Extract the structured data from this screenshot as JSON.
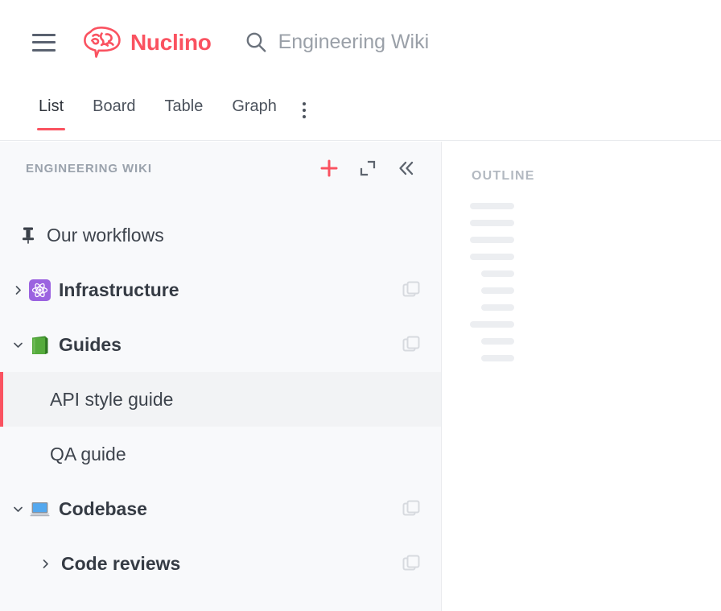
{
  "brand": {
    "name": "Nuclino",
    "color": "#fa5260",
    "logo_icon": "brain-speech-bubble-icon",
    "menu_icon": "hamburger-menu-icon"
  },
  "search": {
    "icon": "search-icon",
    "value": "Engineering Wiki",
    "placeholder": "Engineering Wiki"
  },
  "tabs": {
    "items": [
      {
        "label": "List",
        "active": true
      },
      {
        "label": "Board",
        "active": false
      },
      {
        "label": "Table",
        "active": false
      },
      {
        "label": "Graph",
        "active": false
      }
    ],
    "more_icon": "more-vertical-icon",
    "active_indicator_color": "#fa5260"
  },
  "sidebar": {
    "title": "ENGINEERING WIKI",
    "actions": [
      {
        "name": "add-item-button",
        "icon": "plus-icon",
        "color": "#fa5260"
      },
      {
        "name": "expand-button",
        "icon": "expand-diagonal-icon",
        "color": "#6b7280"
      },
      {
        "name": "collapse-sidebar-button",
        "icon": "chevron-double-left-icon",
        "color": "#6b7280"
      }
    ],
    "items": [
      {
        "label": "Our workflows",
        "icon": "pushpin-icon",
        "emoji": "",
        "toggle": "none",
        "indent": 0,
        "bold": false,
        "selected": false,
        "has_copy": false
      },
      {
        "label": "Infrastructure",
        "icon": "atom-emoji",
        "emoji": "⚛",
        "toggle": "collapsed",
        "indent": 0,
        "bold": true,
        "selected": false,
        "has_copy": true
      },
      {
        "label": "Guides",
        "icon": "green-book-emoji",
        "emoji": "📗",
        "toggle": "expanded",
        "indent": 0,
        "bold": true,
        "selected": false,
        "has_copy": true
      },
      {
        "label": "API style guide",
        "icon": "",
        "emoji": "",
        "toggle": "none",
        "indent": 1,
        "bold": false,
        "selected": true,
        "has_copy": false
      },
      {
        "label": "QA guide",
        "icon": "",
        "emoji": "",
        "toggle": "none",
        "indent": 1,
        "bold": false,
        "selected": false,
        "has_copy": false
      },
      {
        "label": "Codebase",
        "icon": "laptop-emoji",
        "emoji": "💻",
        "toggle": "expanded",
        "indent": 0,
        "bold": true,
        "selected": false,
        "has_copy": true
      },
      {
        "label": "Code reviews",
        "icon": "",
        "emoji": "",
        "toggle": "collapsed",
        "indent": 2,
        "bold": true,
        "selected": false,
        "has_copy": true
      }
    ],
    "copy_icon": "duplicate-icon",
    "selected_accent_color": "#fa5260",
    "selected_row_bg": "#f2f3f5",
    "background": "#f8f9fb"
  },
  "outline": {
    "title": "OUTLINE",
    "placeholder_rows": [
      {
        "indent": 0
      },
      {
        "indent": 0
      },
      {
        "indent": 0
      },
      {
        "indent": 0
      },
      {
        "indent": 1
      },
      {
        "indent": 1
      },
      {
        "indent": 1
      },
      {
        "indent": 0
      },
      {
        "indent": 1
      },
      {
        "indent": 1
      }
    ],
    "placeholder_color": "#eceef1"
  }
}
